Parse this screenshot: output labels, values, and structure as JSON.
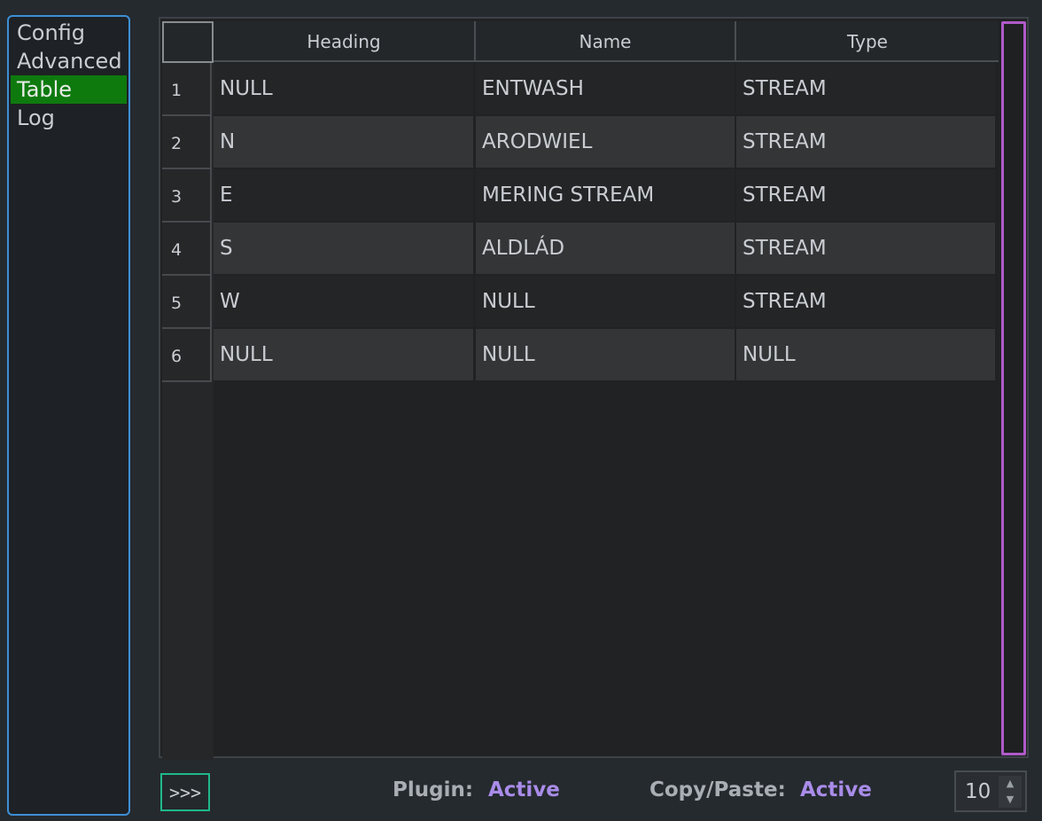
{
  "sidebar": {
    "items": [
      {
        "label": "Config"
      },
      {
        "label": "Advanced"
      },
      {
        "label": "Table",
        "selected": true
      },
      {
        "label": "Log"
      }
    ]
  },
  "table": {
    "columns": [
      "Heading",
      "Name",
      "Type"
    ],
    "rows": [
      {
        "index": "1",
        "cells": [
          "NULL",
          "ENTWASH",
          "STREAM"
        ]
      },
      {
        "index": "2",
        "cells": [
          "N",
          "ARODWIEL",
          "STREAM"
        ]
      },
      {
        "index": "3",
        "cells": [
          "E",
          "MERING STREAM",
          "STREAM"
        ]
      },
      {
        "index": "4",
        "cells": [
          "S",
          "ALDLÁD",
          "STREAM"
        ]
      },
      {
        "index": "5",
        "cells": [
          "W",
          "NULL",
          "STREAM"
        ]
      },
      {
        "index": "6",
        "cells": [
          "NULL",
          "NULL",
          "NULL"
        ]
      }
    ]
  },
  "footer": {
    "execute_label": ">>>",
    "plugin_label": "Plugin:",
    "plugin_status": "Active",
    "copypaste_label": "Copy/Paste:",
    "copypaste_status": "Active",
    "spin_value": "10",
    "spin_up_glyph": "▲",
    "spin_down_glyph": "▼"
  },
  "colors": {
    "sidebar_border": "#3d8fd6",
    "selected_bg": "#0e7a0e",
    "scrollbar_border": "#b05ac8",
    "exec_border": "#1fb88a",
    "status_active": "#a98ce9"
  }
}
